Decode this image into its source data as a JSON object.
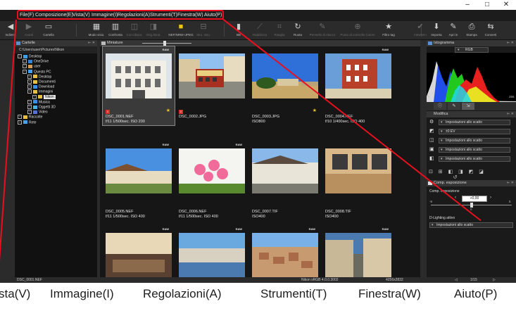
{
  "title_bar": {
    "controls": [
      "–",
      "□",
      "✕"
    ]
  },
  "menu": [
    "File(F)",
    "Composizione(E)",
    "Vista(V)",
    "Immagine(I)",
    "Regolazioni(A)",
    "Strumenti(T)",
    "Finestra(W)",
    "Aiuto(P)"
  ],
  "toolbar": [
    {
      "label": "Indietro",
      "icon": "back-arrow-icon",
      "state": "normal"
    },
    {
      "label": "Avanti",
      "icon": "forward-arrow-icon",
      "state": "dim"
    },
    {
      "label": "Cartella",
      "icon": "folder-icon",
      "state": "normal"
    },
    {
      "label": "Modo visio.",
      "icon": "grid-view-icon",
      "state": "normal"
    },
    {
      "label": "Confronta",
      "icon": "compare-icon",
      "state": "normal"
    },
    {
      "label": "Corr./dispo.",
      "icon": "correct-icon",
      "state": "dim"
    },
    {
      "label": "Orig./Mod.",
      "icon": "original-icon",
      "state": "dim"
    },
    {
      "label": "NEF/NRW+JPEG",
      "icon": "nef-jpeg-icon",
      "state": "highlight"
    },
    {
      "label": "Stru. visu.",
      "icon": "view-tools-icon",
      "state": "dim"
    },
    {
      "label": "BB",
      "icon": "bb-icon",
      "state": "normal"
    },
    {
      "label": "Raddrizza",
      "icon": "straighten-icon",
      "state": "dim"
    },
    {
      "label": "Ritaglia",
      "icon": "crop-icon",
      "state": "dim"
    },
    {
      "label": "Ruota",
      "icon": "rotate-icon",
      "state": "normal"
    },
    {
      "label": "Pennello di ritocco",
      "icon": "brush-icon",
      "state": "dim"
    },
    {
      "label": "Punto di controllo Colore",
      "icon": "color-point-icon",
      "state": "dim"
    },
    {
      "label": "Filtro tag",
      "icon": "star-icon",
      "state": "normal"
    },
    {
      "label": "ViewNX-i",
      "icon": "viewnx-icon",
      "state": "dim"
    },
    {
      "label": "Importa",
      "icon": "import-icon",
      "state": "normal"
    },
    {
      "label": "Apri in",
      "icon": "open-in-icon",
      "state": "normal"
    },
    {
      "label": "Stampa",
      "icon": "print-icon",
      "state": "normal"
    },
    {
      "label": "Converti",
      "icon": "convert-icon",
      "state": "normal"
    }
  ],
  "folders_panel": {
    "title": "Cartelle",
    "path": "C:\\Users\\user\\Pictures\\Nikon",
    "tree": [
      {
        "label": "Desktop",
        "level": 0,
        "icon": "desktop-icon"
      },
      {
        "label": "OneDrive",
        "level": 1,
        "icon": "cloud-icon"
      },
      {
        "label": "user",
        "level": 1,
        "icon": "user-icon"
      },
      {
        "label": "Questo PC",
        "level": 1,
        "icon": "computer-icon"
      },
      {
        "label": "Desktop",
        "level": 2,
        "icon": "folder-icon"
      },
      {
        "label": "Documenti",
        "level": 2,
        "icon": "folder-icon"
      },
      {
        "label": "Download",
        "level": 2,
        "icon": "download-icon"
      },
      {
        "label": "Immagini",
        "level": 2,
        "icon": "folder-icon"
      },
      {
        "label": "Nikon",
        "level": 3,
        "icon": "folder-icon",
        "selected": true
      },
      {
        "label": "Musica",
        "level": 2,
        "icon": "music-icon"
      },
      {
        "label": "Oggetti 3D",
        "level": 2,
        "icon": "cube-icon"
      },
      {
        "label": "Video",
        "level": 2,
        "icon": "video-icon"
      },
      {
        "label": "Raccolte",
        "level": 0,
        "icon": "folder-icon"
      },
      {
        "label": "Rete",
        "level": 0,
        "icon": "network-icon"
      }
    ]
  },
  "thumbs_panel": {
    "title": "Miniature"
  },
  "thumbnails": [
    {
      "name": "DSC_0001.NEF",
      "info": "f/11 1/500sec. ISO 200",
      "raw": true,
      "selected": true,
      "flag": "1",
      "star": true,
      "photo": "white-building"
    },
    {
      "name": "DSC_0002.JPG",
      "info": "",
      "raw": false,
      "selected": false,
      "flag": "2",
      "star": false,
      "photo": "cable-car"
    },
    {
      "name": "DSC_0003.JPG",
      "info": "ISO800",
      "raw": false,
      "selected": false,
      "flag": "",
      "star": true,
      "photo": "blue-sky-tree"
    },
    {
      "name": "DSC_0004.NEF",
      "info": "f/10 1/400sec. ISO 400",
      "raw": true,
      "selected": false,
      "flag": "",
      "star": false,
      "photo": "red-building"
    },
    {
      "name": "DSC_0005.NEF",
      "info": "f/11 1/500sec. ISO 400",
      "raw": true,
      "selected": false,
      "flag": "",
      "star": false,
      "photo": "village"
    },
    {
      "name": "DSC_0006.NEF",
      "info": "f/11 1/500sec. ISO 400",
      "raw": true,
      "selected": false,
      "flag": "",
      "star": false,
      "photo": "flowers"
    },
    {
      "name": "DSC_0007.TIF",
      "info": "ISO400",
      "raw": false,
      "selected": false,
      "flag": "",
      "star": false,
      "photo": "cottages"
    },
    {
      "name": "DSC_0008.TIF",
      "info": "ISO400",
      "raw": false,
      "selected": false,
      "flag": "",
      "star": false,
      "photo": "windows"
    },
    {
      "name": "",
      "info": "",
      "raw": true,
      "selected": false,
      "flag": "",
      "star": false,
      "photo": "interior"
    },
    {
      "name": "",
      "info": "",
      "raw": true,
      "selected": false,
      "flag": "",
      "star": false,
      "photo": "harbor"
    },
    {
      "name": "",
      "info": "",
      "raw": true,
      "selected": false,
      "flag": "",
      "star": false,
      "photo": "town-aerial"
    },
    {
      "name": "",
      "info": "",
      "raw": true,
      "selected": false,
      "flag": "",
      "star": false,
      "photo": "street"
    }
  ],
  "histogram_panel": {
    "title": "Istogramma",
    "channel": "RGB",
    "min": "0",
    "max": "255"
  },
  "edit_panel": {
    "title": "Modifica",
    "rows": [
      {
        "icon": "gear-icon",
        "value": "Impostazioni allo scatto"
      },
      {
        "icon": "exposure-icon",
        "value": "±0 EV"
      },
      {
        "icon": "wb-icon",
        "value": "Impostazioni allo scatto"
      },
      {
        "icon": "picture-control-icon",
        "value": "Impostazioni allo scatto"
      },
      {
        "icon": "lens-icon",
        "value": "Impostazioni allo scatto"
      }
    ]
  },
  "exposure_panel": {
    "title": "Comp. esposizione",
    "label": "Comp. esposizione",
    "value": "+0,00",
    "scale": [
      "-5",
      "0",
      "5"
    ],
    "slider_position": 0.5,
    "dlighting_label": "D-Lighting attivo",
    "dlighting_value": "Impostazioni allo scatto"
  },
  "status_bar": {
    "file": "DSC_0001.NEF",
    "profile": "Nikon sRGB 4.0.0.3002",
    "size": "4256x2832",
    "page": "1/15"
  },
  "zoom_callout": {
    "items": [
      "sta(V)",
      "Immagine(I)",
      "Regolazioni(A)",
      "Strumenti(T)",
      "Finestra(W)",
      "Aiuto(P)"
    ]
  },
  "colors": {
    "highlight": "#e8101e",
    "accent": "#f1c40f",
    "background": "#1f1f1f"
  }
}
